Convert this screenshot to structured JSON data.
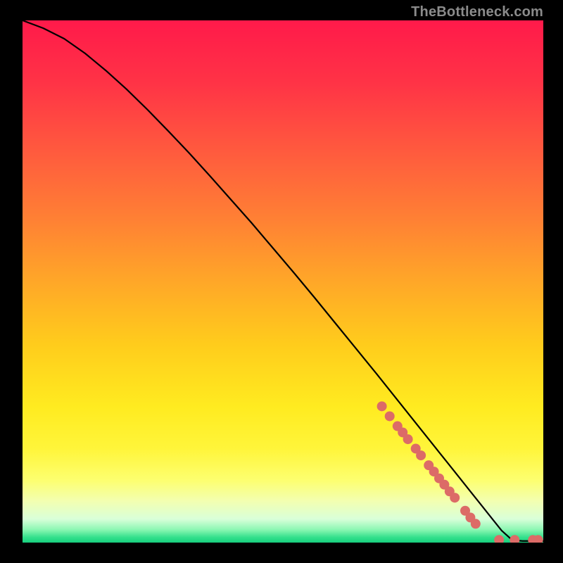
{
  "watermark": "TheBottleneck.com",
  "chart_data": {
    "type": "line",
    "title": "",
    "xlabel": "",
    "ylabel": "",
    "xlim": [
      0,
      100
    ],
    "ylim": [
      0,
      100
    ],
    "grid": false,
    "legend": false,
    "series": [
      {
        "name": "curve",
        "type": "line",
        "color": "#000000",
        "x": [
          0,
          4,
          8,
          12,
          16,
          20,
          24,
          28,
          32,
          36,
          40,
          44,
          48,
          52,
          56,
          60,
          64,
          68,
          72,
          76,
          80,
          84,
          86,
          88,
          90,
          92,
          94,
          96,
          98,
          100
        ],
        "y": [
          100,
          98.5,
          96.5,
          93.7,
          90.4,
          86.8,
          82.9,
          78.8,
          74.6,
          70.2,
          65.7,
          61.2,
          56.5,
          51.8,
          47.0,
          42.1,
          37.2,
          32.3,
          27.3,
          22.3,
          17.3,
          12.3,
          9.8,
          7.3,
          4.8,
          2.3,
          0.5,
          0.3,
          0.3,
          0.3
        ]
      },
      {
        "name": "markers",
        "type": "scatter",
        "color": "#dc6b67",
        "x": [
          69,
          70.5,
          72,
          73,
          74,
          75.5,
          76.5,
          78,
          79,
          80,
          81,
          82,
          83,
          85,
          86,
          87,
          91.5,
          94.5,
          98,
          99
        ],
        "y": [
          26.1,
          24.2,
          22.3,
          21.1,
          19.8,
          18.0,
          16.7,
          14.8,
          13.6,
          12.3,
          11.1,
          9.8,
          8.6,
          6.1,
          4.8,
          3.6,
          0.5,
          0.5,
          0.5,
          0.5
        ]
      }
    ],
    "background_gradient": {
      "stops": [
        {
          "pos": 0.0,
          "color": "#ff1a4a"
        },
        {
          "pos": 0.12,
          "color": "#ff3346"
        },
        {
          "pos": 0.25,
          "color": "#ff5a3e"
        },
        {
          "pos": 0.38,
          "color": "#ff8034"
        },
        {
          "pos": 0.5,
          "color": "#ffa728"
        },
        {
          "pos": 0.62,
          "color": "#ffcc1c"
        },
        {
          "pos": 0.74,
          "color": "#ffeb20"
        },
        {
          "pos": 0.82,
          "color": "#fff53a"
        },
        {
          "pos": 0.88,
          "color": "#fdff6f"
        },
        {
          "pos": 0.92,
          "color": "#f3ffb0"
        },
        {
          "pos": 0.955,
          "color": "#d9ffd9"
        },
        {
          "pos": 0.975,
          "color": "#8cf7b3"
        },
        {
          "pos": 0.99,
          "color": "#34e08c"
        },
        {
          "pos": 1.0,
          "color": "#17cf7e"
        }
      ]
    }
  }
}
